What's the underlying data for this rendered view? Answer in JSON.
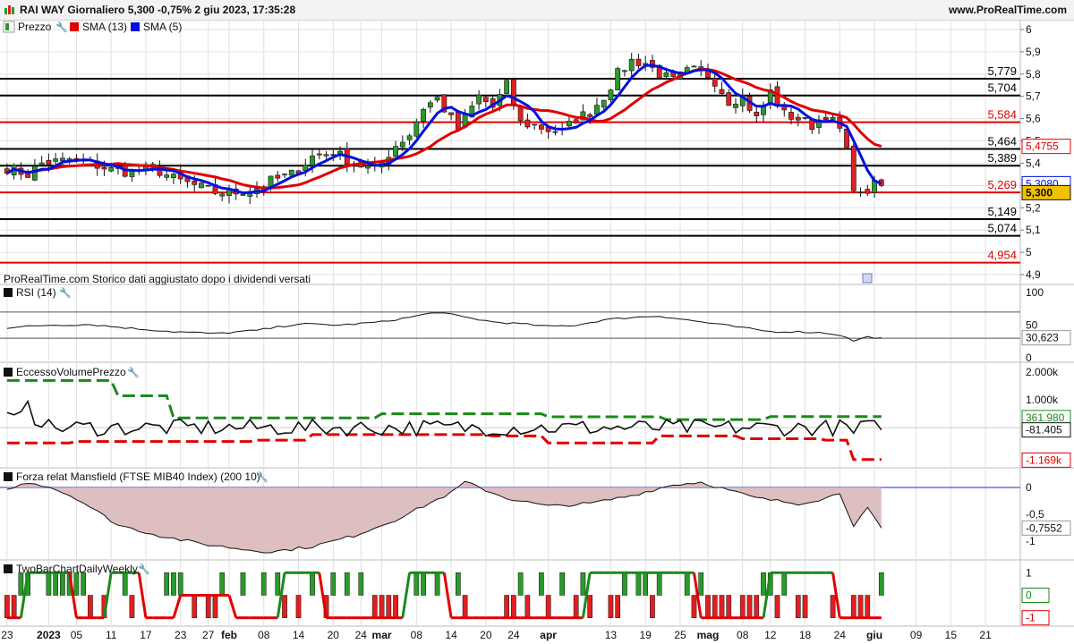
{
  "header": {
    "title": "RAI WAY Giornaliero 5,300 -0,75% 2 giu 2023, 17:35:28",
    "site": "www.ProRealTime.com"
  },
  "legend": {
    "price_label": "Prezzo",
    "sma13_label": "SMA (13)",
    "sma5_label": "SMA (5)"
  },
  "footnote": "ProRealTime.com  Storico dati aggiustato dopo i dividendi versati",
  "colors": {
    "sma13": "#e00000",
    "sma5": "#0010e0",
    "up": "#2a9a2a",
    "down": "#e02020",
    "green_dash": "#1a8a1a",
    "mansfield_fill": "#d9b8b8",
    "grid": "#e0e0e0"
  },
  "chart_data": [
    {
      "type": "candlestick",
      "panel": "Prezzo",
      "ylim": [
        4.88,
        6.02
      ],
      "yticks": [
        "6",
        "5,9",
        "5,8",
        "5,7",
        "5,6",
        "5,5",
        "5,4",
        "5,3",
        "5,2",
        "5,1",
        "5",
        "4,9"
      ],
      "ytick_values": [
        6,
        5.9,
        5.8,
        5.7,
        5.6,
        5.5,
        5.4,
        5.3,
        5.2,
        5.1,
        5.0,
        4.9
      ],
      "xticks": [
        "23",
        "2023",
        "05",
        "11",
        "17",
        "23",
        "27",
        "feb",
        "08",
        "14",
        "20",
        "24",
        "mar",
        "08",
        "14",
        "20",
        "24",
        "apr",
        "13",
        "19",
        "25",
        "mag",
        "08",
        "12",
        "18",
        "24",
        "giu",
        "09",
        "15",
        "21"
      ],
      "xtick_bar_index": [
        0,
        6,
        10,
        15,
        20,
        25,
        29,
        32,
        37,
        42,
        47,
        51,
        54,
        59,
        64,
        69,
        73,
        78,
        87,
        92,
        97,
        101,
        106,
        110,
        115,
        120,
        125,
        131,
        136,
        141
      ],
      "levels": [
        {
          "label": "5,779",
          "value": 5.779,
          "color": "black"
        },
        {
          "label": "5,704",
          "value": 5.704,
          "color": "black"
        },
        {
          "label": "5,584",
          "value": 5.584,
          "color": "red"
        },
        {
          "label": "5,464",
          "value": 5.464,
          "color": "black"
        },
        {
          "label": "5,389",
          "value": 5.389,
          "color": "black"
        },
        {
          "label": "5,269",
          "value": 5.269,
          "color": "red"
        },
        {
          "label": "5,149",
          "value": 5.149,
          "color": "black"
        },
        {
          "label": "5,074",
          "value": 5.074,
          "color": "black"
        },
        {
          "label": "4,954",
          "value": 4.954,
          "color": "red"
        }
      ],
      "last_values": {
        "sma13": "5,4755",
        "sma5": "5,3080",
        "price": "5,300"
      },
      "sma13_value": 5.4755,
      "sma5_value": 5.308,
      "price_value": 5.3,
      "close_keypoints": [
        [
          0,
          5.38
        ],
        [
          3,
          5.35
        ],
        [
          5,
          5.4
        ],
        [
          8,
          5.41
        ],
        [
          12,
          5.4
        ],
        [
          15,
          5.37
        ],
        [
          18,
          5.36
        ],
        [
          21,
          5.38
        ],
        [
          24,
          5.33
        ],
        [
          27,
          5.3
        ],
        [
          30,
          5.27
        ],
        [
          33,
          5.27
        ],
        [
          36,
          5.29
        ],
        [
          38,
          5.32
        ],
        [
          41,
          5.35
        ],
        [
          44,
          5.43
        ],
        [
          47,
          5.45
        ],
        [
          50,
          5.4
        ],
        [
          53,
          5.37
        ],
        [
          56,
          5.48
        ],
        [
          58,
          5.53
        ],
        [
          60,
          5.65
        ],
        [
          62,
          5.69
        ],
        [
          65,
          5.55
        ],
        [
          68,
          5.7
        ],
        [
          70,
          5.65
        ],
        [
          72,
          5.75
        ],
        [
          74,
          5.58
        ],
        [
          76,
          5.57
        ],
        [
          78,
          5.55
        ],
        [
          80,
          5.54
        ],
        [
          82,
          5.6
        ],
        [
          84,
          5.63
        ],
        [
          86,
          5.7
        ],
        [
          88,
          5.8
        ],
        [
          90,
          5.86
        ],
        [
          92,
          5.85
        ],
        [
          94,
          5.8
        ],
        [
          96,
          5.77
        ],
        [
          98,
          5.81
        ],
        [
          100,
          5.82
        ],
        [
          102,
          5.77
        ],
        [
          104,
          5.68
        ],
        [
          106,
          5.7
        ],
        [
          108,
          5.6
        ],
        [
          110,
          5.72
        ],
        [
          112,
          5.62
        ],
        [
          114,
          5.6
        ],
        [
          116,
          5.57
        ],
        [
          118,
          5.62
        ],
        [
          120,
          5.55
        ],
        [
          121,
          5.45
        ],
        [
          122,
          5.3
        ],
        [
          123,
          5.25
        ],
        [
          124,
          5.28
        ],
        [
          125,
          5.3
        ]
      ]
    },
    {
      "type": "line",
      "panel": "RSI (14)",
      "ylim": [
        0,
        100
      ],
      "yticks": [
        "100",
        "50",
        "0"
      ],
      "ytick_values": [
        100,
        50,
        0
      ],
      "reference_lines": [
        70,
        30
      ],
      "last_value_label": "30,623",
      "last_value": 30.623,
      "keypoints": [
        [
          0,
          46
        ],
        [
          6,
          50
        ],
        [
          12,
          51
        ],
        [
          18,
          45
        ],
        [
          24,
          40
        ],
        [
          30,
          37
        ],
        [
          36,
          42
        ],
        [
          42,
          52
        ],
        [
          48,
          50
        ],
        [
          54,
          55
        ],
        [
          58,
          62
        ],
        [
          62,
          70
        ],
        [
          66,
          62
        ],
        [
          70,
          55
        ],
        [
          74,
          52
        ],
        [
          78,
          48
        ],
        [
          82,
          50
        ],
        [
          86,
          58
        ],
        [
          90,
          62
        ],
        [
          94,
          64
        ],
        [
          98,
          58
        ],
        [
          102,
          52
        ],
        [
          106,
          46
        ],
        [
          110,
          40
        ],
        [
          114,
          40
        ],
        [
          118,
          38
        ],
        [
          120,
          35
        ],
        [
          122,
          26
        ],
        [
          124,
          32
        ],
        [
          126,
          30.6
        ]
      ]
    },
    {
      "type": "line",
      "panel": "EccessoVolumePrezzo",
      "ylim": [
        -1350,
        2100
      ],
      "yticks": [
        "2.000k",
        "1.000k",
        "0"
      ],
      "ytick_values": [
        2000,
        1000,
        0
      ],
      "last_value_labels": [
        "361.980",
        "-81.405",
        "-1.169k"
      ],
      "last_values": [
        361.98,
        -81.405,
        -1169
      ],
      "green_steps": [
        [
          0,
          1700
        ],
        [
          16,
          1150
        ],
        [
          24,
          350
        ],
        [
          54,
          500
        ],
        [
          78,
          390
        ],
        [
          95,
          290
        ],
        [
          110,
          400
        ]
      ],
      "red_steps": [
        [
          0,
          -550
        ],
        [
          10,
          -500
        ],
        [
          36,
          -450
        ],
        [
          44,
          -250
        ],
        [
          70,
          -300
        ],
        [
          78,
          -550
        ],
        [
          94,
          -300
        ],
        [
          106,
          -400
        ],
        [
          118,
          -450
        ],
        [
          122,
          -1150
        ]
      ]
    },
    {
      "type": "area",
      "panel": "Forza relat Mansfield (FTSE MIB40 Index) (200 10)",
      "ylim": [
        -1.25,
        0.25
      ],
      "yticks": [
        "0",
        "-0,5",
        "-1"
      ],
      "ytick_values": [
        0,
        -0.5,
        -1
      ],
      "last_value_label": "-0,7552",
      "last_value": -0.7552,
      "keypoints": [
        [
          0,
          -0.05
        ],
        [
          3,
          0.1
        ],
        [
          6,
          0.02
        ],
        [
          10,
          -0.2
        ],
        [
          16,
          -0.7
        ],
        [
          22,
          -0.9
        ],
        [
          28,
          -1.05
        ],
        [
          34,
          -1.15
        ],
        [
          38,
          -1.2
        ],
        [
          44,
          -1.1
        ],
        [
          50,
          -0.9
        ],
        [
          56,
          -0.6
        ],
        [
          60,
          -0.35
        ],
        [
          64,
          -0.1
        ],
        [
          66,
          0.1
        ],
        [
          68,
          0.0
        ],
        [
          72,
          -0.2
        ],
        [
          78,
          -0.35
        ],
        [
          84,
          -0.3
        ],
        [
          90,
          -0.15
        ],
        [
          96,
          0.05
        ],
        [
          100,
          0.1
        ],
        [
          104,
          -0.05
        ],
        [
          108,
          -0.2
        ],
        [
          114,
          -0.3
        ],
        [
          118,
          -0.2
        ],
        [
          120,
          -0.1
        ],
        [
          122,
          -0.7
        ],
        [
          124,
          -0.4
        ],
        [
          126,
          -0.76
        ]
      ]
    },
    {
      "type": "bar",
      "panel": "TwoBarChartDailyWeekly",
      "ylim": [
        -1.25,
        1.25
      ],
      "yticks": [
        "1",
        "0",
        "-1"
      ],
      "ytick_values": [
        1,
        0,
        -1
      ],
      "last_value_labels": [
        "0",
        "-1"
      ],
      "last_values": [
        0,
        -1
      ],
      "weekly_line_steps": [
        [
          0,
          -1
        ],
        [
          3,
          1
        ],
        [
          10,
          -1
        ],
        [
          15,
          1
        ],
        [
          20,
          -1
        ],
        [
          25,
          0
        ],
        [
          33,
          -1
        ],
        [
          40,
          1
        ],
        [
          46,
          -1
        ],
        [
          58,
          1
        ],
        [
          64,
          -1
        ],
        [
          78,
          -1
        ],
        [
          84,
          1
        ],
        [
          96,
          1
        ],
        [
          100,
          -1
        ],
        [
          107,
          -1
        ],
        [
          110,
          1
        ],
        [
          120,
          -1
        ],
        [
          126,
          -1
        ]
      ]
    }
  ],
  "panel_titles": {
    "rsi": "RSI (14)",
    "evp": "EccessoVolumePrezzo",
    "mansfield": "Forza relat Mansfield (FTSE MIB40 Index) (200 10)",
    "twobar": "TwoBarChartDailyWeekly"
  }
}
